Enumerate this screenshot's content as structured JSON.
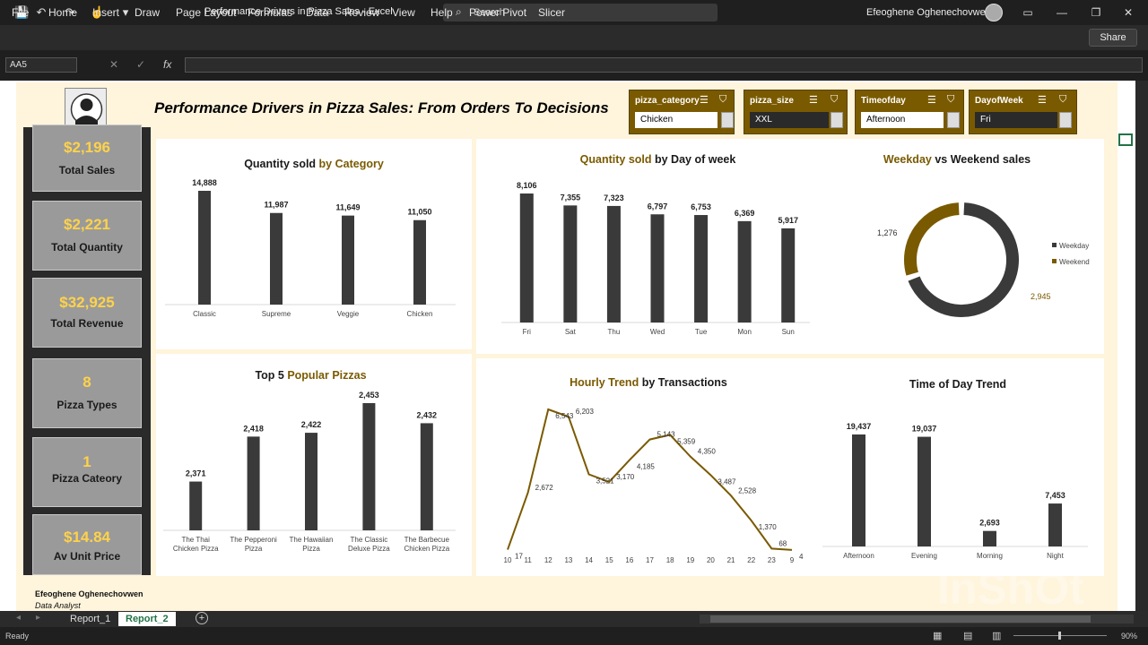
{
  "titlebar": {
    "doc_title": "Performance Drivers in Pizza Sales  -  Excel",
    "search_placeholder": "Search",
    "user": "Efeoghene Oghenechovwen"
  },
  "ribbon": {
    "tabs": [
      "File",
      "Home",
      "Insert",
      "Draw",
      "Page Layout",
      "Formulas",
      "Data",
      "Review",
      "View",
      "Help",
      "Power Pivot",
      "Slicer"
    ],
    "share": "Share"
  },
  "formula_bar": {
    "name_box": "AA5",
    "fx": "fx"
  },
  "dashboard": {
    "title": "Performance Drivers in Pizza Sales: From Orders To Decisions",
    "author": "Efeoghene Oghenechovwen",
    "role": "Data Analyst",
    "kpis": [
      {
        "value": "$2,196",
        "label": "Total Sales"
      },
      {
        "value": "$2,221",
        "label": "Total Quantity"
      },
      {
        "value": "$32,925",
        "label": "Total Revenue"
      },
      {
        "value": "8",
        "label": "Pizza Types"
      },
      {
        "value": "1",
        "label": "Pizza Cateory"
      },
      {
        "value": "$14.84",
        "label": "Av Unit Price"
      }
    ],
    "slicers": [
      {
        "title": "pizza_category",
        "value": "Chicken"
      },
      {
        "title": "pizza_size",
        "value": "XXL"
      },
      {
        "title": "Timeofday",
        "value": "Afternoon"
      },
      {
        "title": "DayofWeek",
        "value": "Fri"
      }
    ]
  },
  "charts": {
    "category": {
      "title_a": "Quantity sold ",
      "title_b": "by Category"
    },
    "dow": {
      "title_a": "Quantity sold ",
      "title_b": "by Day of week"
    },
    "weekday": {
      "title_a": "Weekday ",
      "title_b": "vs Weekend sales",
      "label_weekday": "1,276",
      "label_weekend": "2,945"
    },
    "top5": {
      "title_a": "Top 5 ",
      "title_b": "Popular Pizzas"
    },
    "hourly": {
      "title_a": "Hourly Trend ",
      "title_b": "by Transactions"
    },
    "tod": {
      "title": "Time of Day Trend"
    }
  },
  "chart_data": [
    {
      "type": "bar",
      "title": "Quantity sold by Category",
      "categories": [
        "Classic",
        "Supreme",
        "Veggie",
        "Chicken"
      ],
      "values": [
        14888,
        11987,
        11649,
        11050
      ]
    },
    {
      "type": "bar",
      "title": "Quantity sold by Day of week",
      "categories": [
        "Fri",
        "Sat",
        "Thu",
        "Wed",
        "Tue",
        "Mon",
        "Sun"
      ],
      "values": [
        8106,
        7355,
        7323,
        6797,
        6753,
        6369,
        5917
      ]
    },
    {
      "type": "pie",
      "title": "Weekday vs Weekend sales",
      "series": [
        {
          "name": "Weekday",
          "values": [
            2945
          ]
        },
        {
          "name": "Weekend",
          "values": [
            1276
          ]
        }
      ]
    },
    {
      "type": "bar",
      "title": "Top 5 Popular Pizzas",
      "categories": [
        "The Thai Chicken Pizza",
        "The Pepperoni Pizza",
        "The Hawaiian Pizza",
        "The Classic Deluxe Pizza",
        "The Barbecue Chicken Pizza"
      ],
      "values": [
        2371,
        2418,
        2422,
        2453,
        2432
      ]
    },
    {
      "type": "line",
      "title": "Hourly Trend by Transactions",
      "x": [
        "10",
        "11",
        "12",
        "13",
        "14",
        "15",
        "16",
        "17",
        "18",
        "19",
        "20",
        "21",
        "22",
        "23",
        "9"
      ],
      "values": [
        17,
        2672,
        6543,
        6203,
        3521,
        3170,
        4185,
        5143,
        5359,
        4350,
        3487,
        2528,
        1370,
        68,
        4
      ]
    },
    {
      "type": "bar",
      "title": "Time of Day Trend",
      "categories": [
        "Afternoon",
        "Evening",
        "Morning",
        "Night"
      ],
      "values": [
        19437,
        19037,
        2693,
        7453
      ]
    }
  ],
  "colors": {
    "bar": "#3a3a3a",
    "accent": "#7a5a00",
    "kpi_value": "#ffd24a",
    "background": "#fff4dc"
  },
  "sheet_tabs": [
    "Report_1",
    "Report_2"
  ],
  "status": {
    "ready": "Ready",
    "zoom": "90%"
  },
  "watermark": "InShOt"
}
